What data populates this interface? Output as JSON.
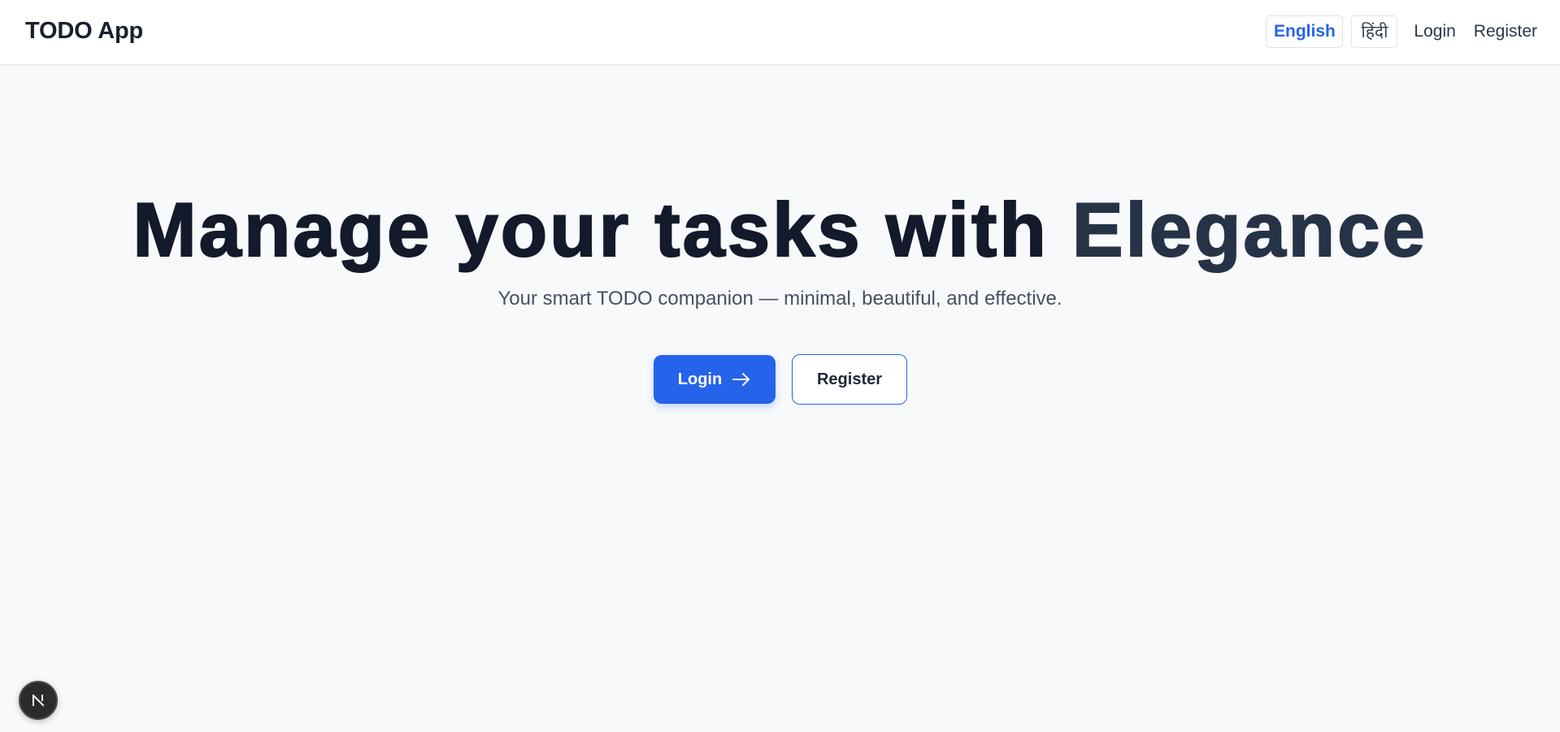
{
  "header": {
    "brand": "TODO App",
    "languages": [
      {
        "label": "English",
        "active": true
      },
      {
        "label": "हिंदी",
        "active": false
      }
    ],
    "login_link": "Login",
    "register_link": "Register"
  },
  "hero": {
    "title_main": "Manage your tasks with ",
    "title_accent": "Elegance",
    "subtitle": "Your smart TODO companion — minimal, beautiful, and effective.",
    "login_button": "Login",
    "register_button": "Register"
  },
  "dev_badge": {
    "label": "N"
  },
  "colors": {
    "primary": "#2563eb",
    "title": "#121a2b",
    "accent_text": "#263347",
    "background": "#f8f9fb"
  },
  "icons": {
    "login_button_icon": "arrow-right-icon",
    "dev_badge_icon": "nextjs-logo-icon"
  }
}
